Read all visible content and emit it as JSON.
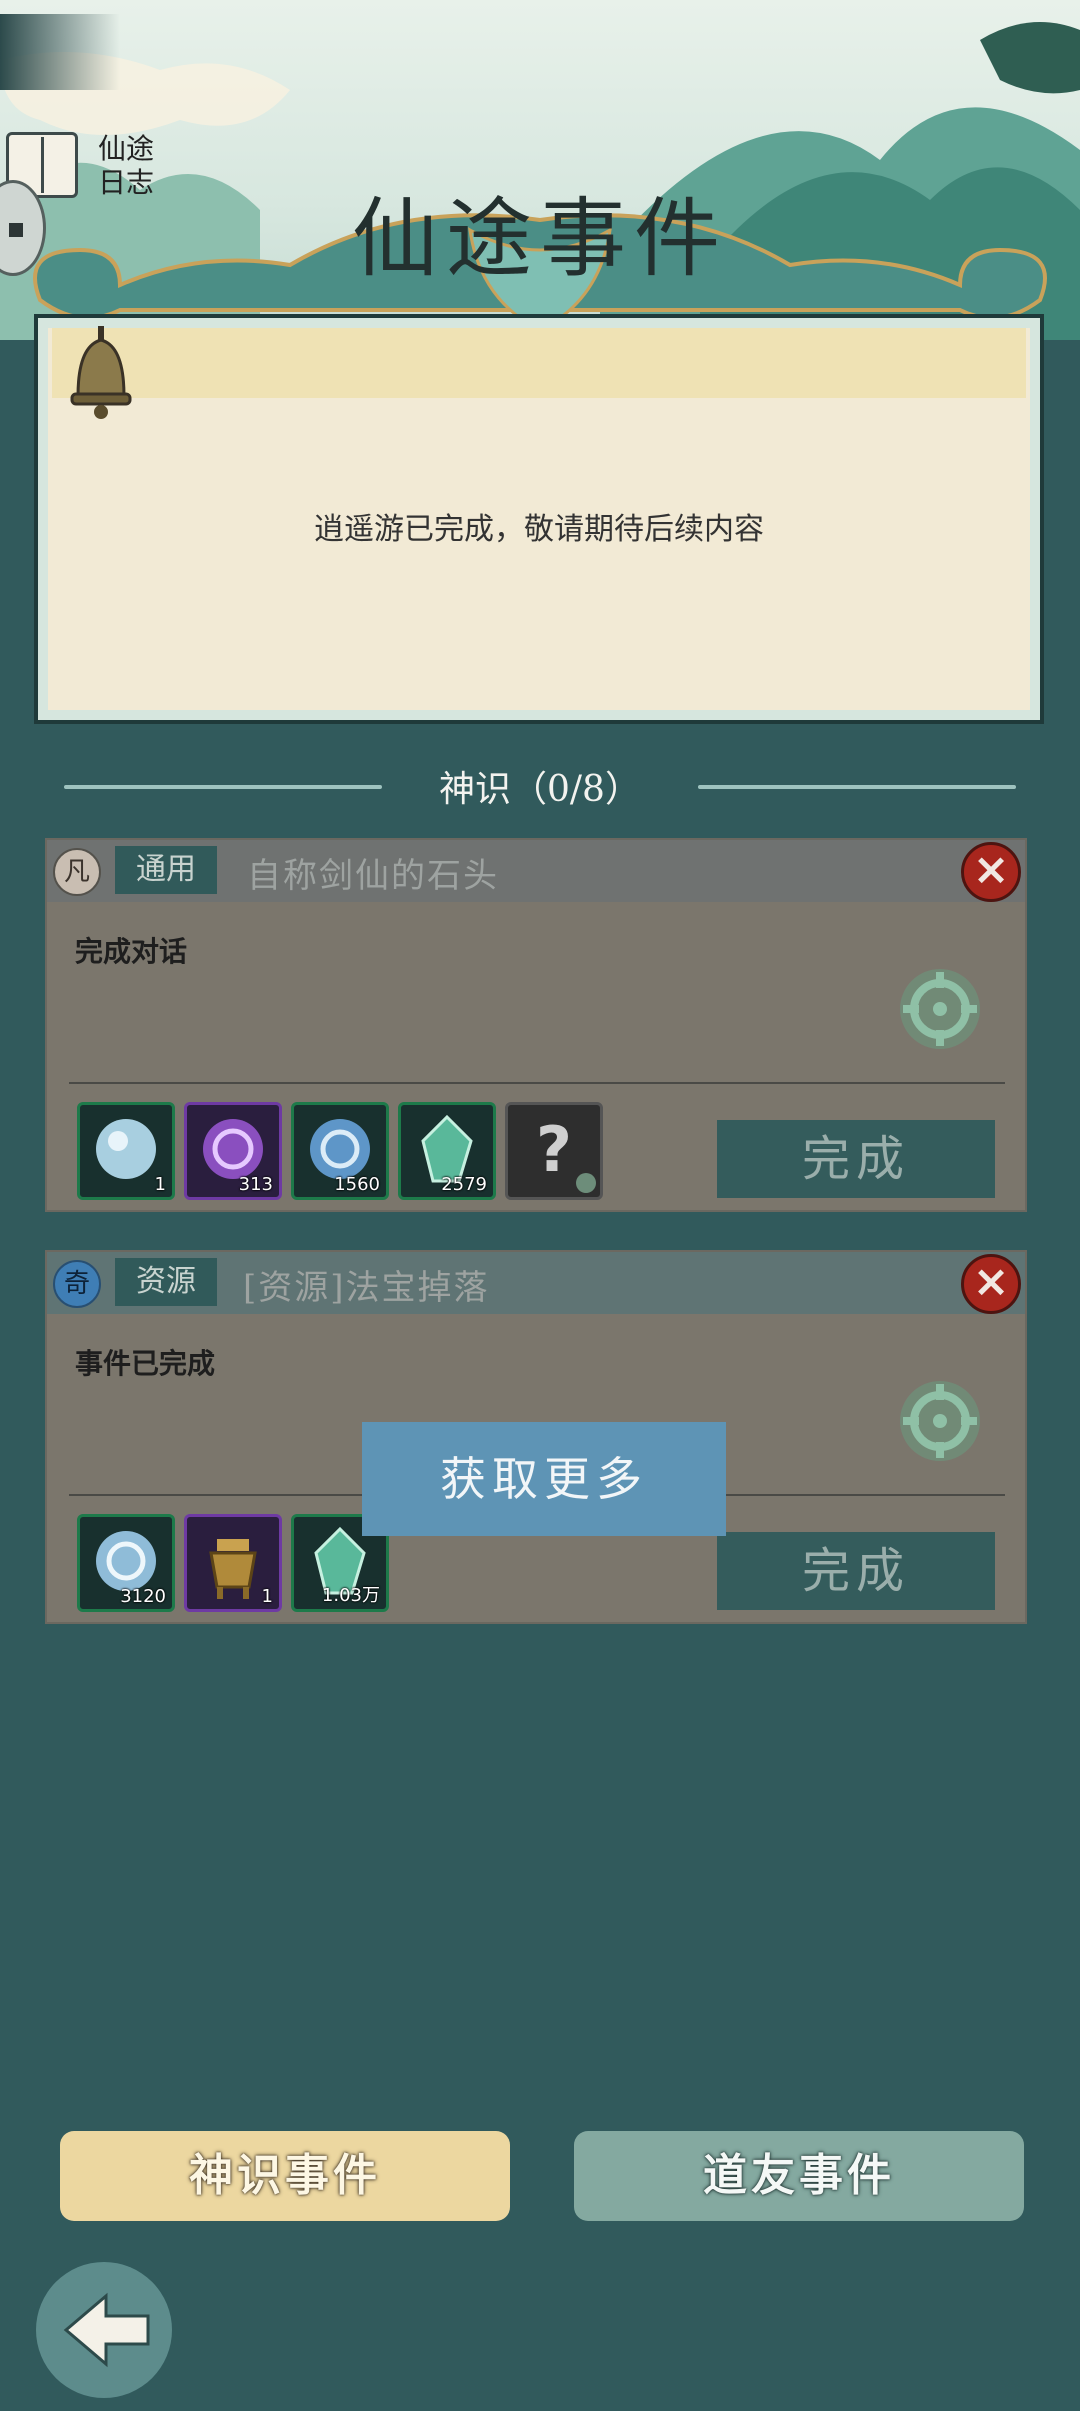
{
  "header": {
    "title": "仙途事件",
    "journal_label": "仙途日志"
  },
  "notice": {
    "text": "逍遥游已完成，敬请期待后续内容"
  },
  "section": {
    "label": "神识（0/8）"
  },
  "events": [
    {
      "rank": "凡",
      "tag": "通用",
      "name": "自称剑仙的石头",
      "description": "完成对话",
      "complete_label": "完成",
      "rewards": [
        {
          "icon": "blue-orb-icon",
          "quantity": "1"
        },
        {
          "icon": "purple-swirl-icon",
          "quantity": "313"
        },
        {
          "icon": "blue-swirl-icon",
          "quantity": "1560"
        },
        {
          "icon": "green-crystal-icon",
          "quantity": "2579"
        },
        {
          "icon": "mystery-item-icon",
          "quantity": ""
        }
      ]
    },
    {
      "rank": "奇",
      "tag": "资源",
      "name": "[资源]法宝掉落",
      "description": "事件已完成",
      "complete_label": "完成",
      "rewards": [
        {
          "icon": "blue-swirl-icon",
          "quantity": "3120"
        },
        {
          "icon": "bronze-cauldron-icon",
          "quantity": "1"
        },
        {
          "icon": "green-crystal-icon",
          "quantity": "1.03万"
        }
      ]
    }
  ],
  "toast": {
    "text": "获取更多"
  },
  "tabs": {
    "shenshi": "神识事件",
    "daoyou": "道友事件"
  },
  "colors": {
    "background": "#315a5c",
    "board": "#f2ead5",
    "close_red": "#a8261d",
    "toast_blue": "#5e94b5",
    "tab_gold": "#ecd7a0",
    "tab_teal": "#84a9a0"
  }
}
